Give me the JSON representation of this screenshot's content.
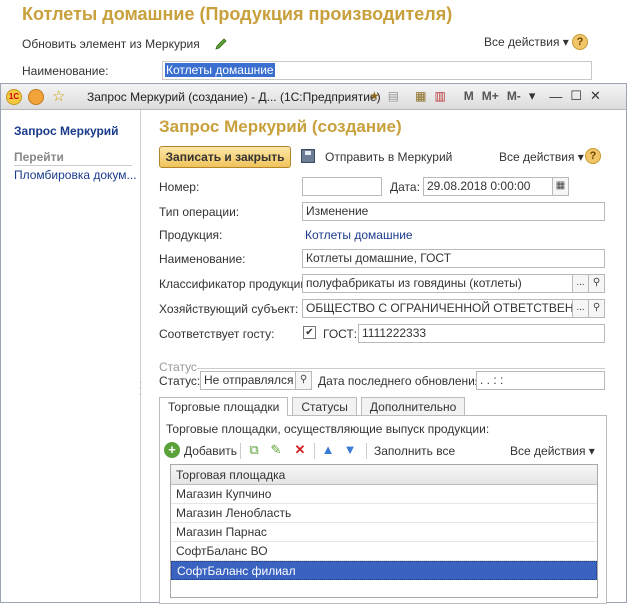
{
  "bg": {
    "title": "Котлеты домашние (Продукция производителя)",
    "update_label": "Обновить элемент из Меркурия",
    "actions_label": "Все действия ▾",
    "help_label": "?",
    "name_label": "Наименование:",
    "name_value": "Котлеты домашние"
  },
  "window": {
    "title": "Запрос Меркурий (создание) - Д... (1С:Предприятие)",
    "logo_text": "1С",
    "m_label": "M",
    "mplus_label": "M+",
    "mminus_label": "M-",
    "dropdown_glyph": "▾",
    "minimize_glyph": "—",
    "maximize_glyph": "☐",
    "close_glyph": "✕"
  },
  "left": {
    "title": "Запрос Меркурий",
    "section": "Перейти",
    "items": [
      "Пломбировка докум..."
    ]
  },
  "form": {
    "title": "Запрос Меркурий (создание)",
    "save_close_label": "Записать и закрыть",
    "send_label": "Отправить в Меркурий",
    "actions_label": "Все действия ▾",
    "help_label": "?",
    "number_label": "Номер:",
    "number_value": "",
    "date_label": "Дата:",
    "date_value": "29.08.2018  0:00:00",
    "op_type_label": "Тип операции:",
    "op_type_value": "Изменение",
    "product_label": "Продукция:",
    "product_value": "Котлеты домашние",
    "name_label": "Наименование:",
    "name_value": "Котлеты домашние, ГОСТ",
    "classifier_label": "Классификатор продукции:",
    "classifier_value": "полуфабрикаты из говядины (котлеты)",
    "entity_label": "Хозяйствующий субъект:",
    "entity_value": "ОБЩЕСТВО С ОГРАНИЧЕННОЙ ОТВЕТСТВЕННОСТ",
    "gost_match_label": "Соответствует госту:",
    "gost_checked": true,
    "gost_label": "ГОСТ:",
    "gost_value": "1111222333",
    "status_group": "Статус",
    "status_label": "Статус:",
    "status_value": "Не отправлялся",
    "last_update_label": "Дата последнего обновления:",
    "last_update_value": " .  .        :  :",
    "ellipsis": "...",
    "search_glyph": "⚲"
  },
  "tabs": [
    {
      "label": "Торговые площадки",
      "active": true
    },
    {
      "label": "Статусы",
      "active": false
    },
    {
      "label": "Дополнительно",
      "active": false
    }
  ],
  "trade_panel": {
    "caption": "Торговые площадки, осуществляющие выпуск продукции:",
    "add_label": "Добавить",
    "fill_all_label": "Заполнить все",
    "actions_label": "Все действия ▾",
    "column_header": "Торговая площадка",
    "rows": [
      "Магазин Купчино",
      "Магазин Ленобласть",
      "Магазин Парнас",
      "СофтБаланс ВО",
      "СофтБаланс филиал"
    ],
    "selected_row": 4
  },
  "colors": {
    "title_gold": "#c8a03c",
    "link_blue": "#1a3b8c",
    "selection_blue": "#3a62c0",
    "primary_button": "#f0c35a"
  }
}
